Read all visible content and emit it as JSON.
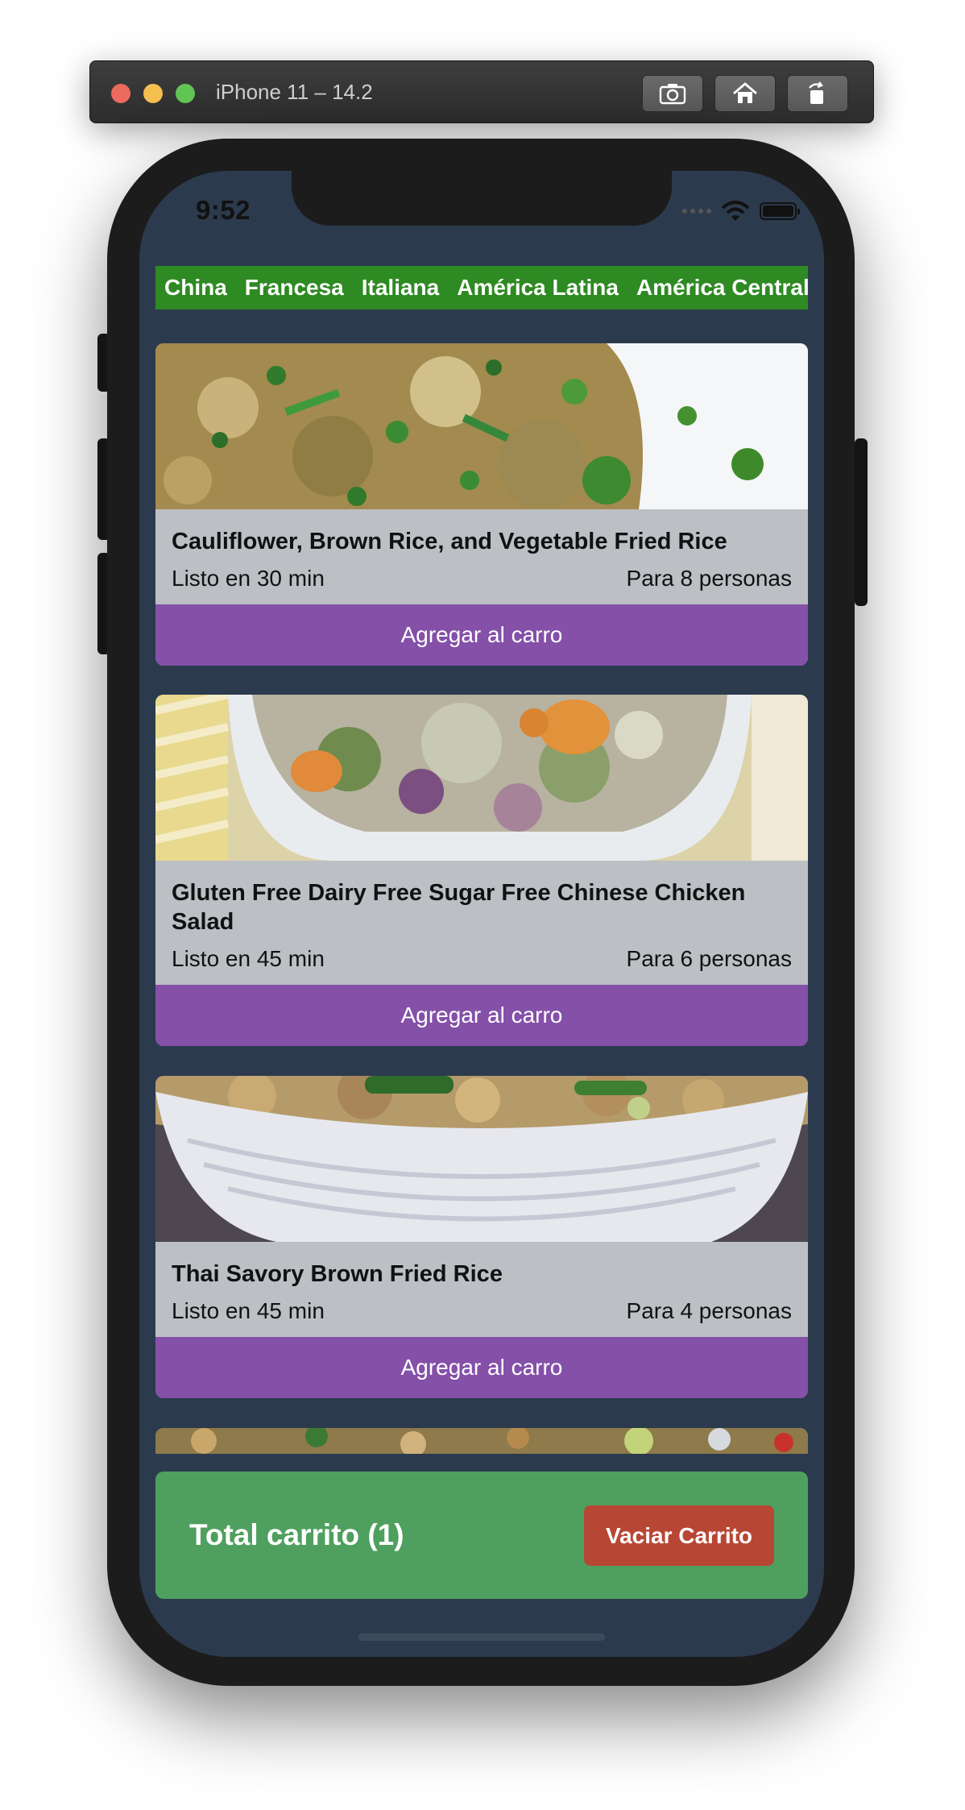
{
  "simulator": {
    "title": "iPhone 11 – 14.2",
    "buttons": [
      "screenshot-icon",
      "home-icon",
      "rotate-icon"
    ]
  },
  "status_bar": {
    "time": "9:52"
  },
  "categories": [
    "China",
    "Francesa",
    "Italiana",
    "América Latina",
    "América Central"
  ],
  "recipes": [
    {
      "title": "Cauliflower, Brown Rice, and Vegetable Fried Rice",
      "ready": "Listo en 30 min",
      "servings": "Para 8 personas",
      "button": "Agregar al carro"
    },
    {
      "title": "Gluten Free Dairy Free Sugar Free Chinese Chicken Salad",
      "ready": "Listo en 45 min",
      "servings": "Para 6 personas",
      "button": "Agregar al carro"
    },
    {
      "title": "Thai Savory Brown Fried Rice",
      "ready": "Listo en 45 min",
      "servings": "Para 4 personas",
      "button": "Agregar al carro"
    }
  ],
  "cart": {
    "total_label": "Total carrito (1)",
    "clear_button": "Vaciar Carrito"
  },
  "colors": {
    "screen_bg": "#2c3a4e",
    "category_bar": "#2e8a22",
    "card_bg": "#bcc0c4",
    "add_button": "#8450a8",
    "cart_bg": "#4f9f5e",
    "clear_button": "#b84634"
  }
}
